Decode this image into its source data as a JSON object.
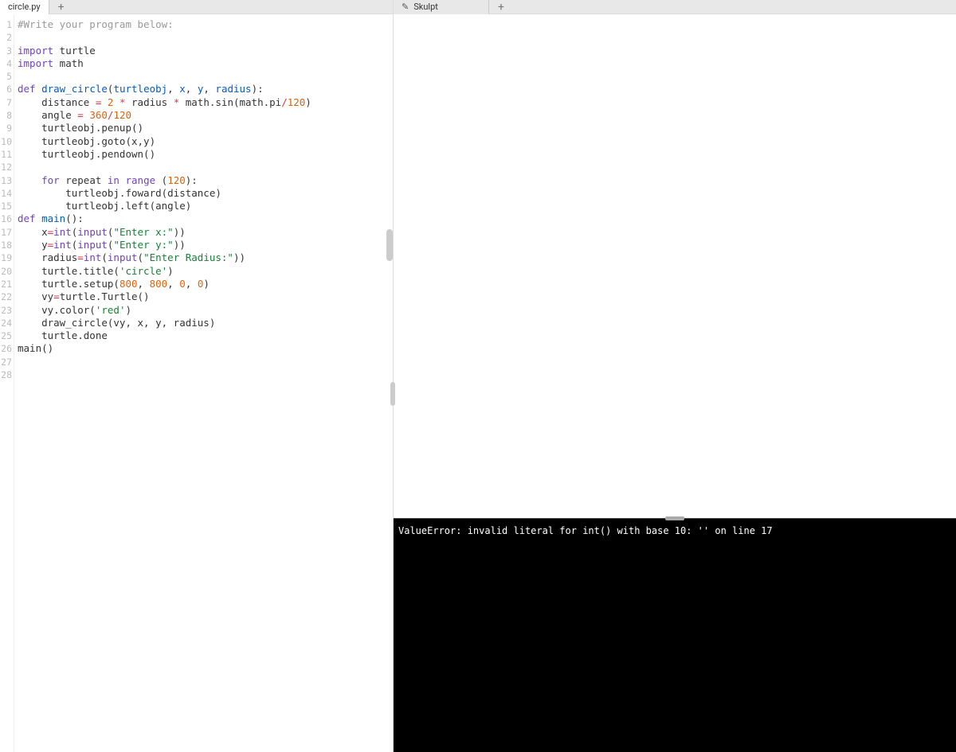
{
  "left_tab": {
    "label": "circle.py"
  },
  "right_tab": {
    "label": "Skulpt",
    "icon": "✎"
  },
  "gutter_max": 28,
  "code_lines": [
    [
      [
        "cmt",
        "#Write your program below:"
      ]
    ],
    [],
    [
      [
        "kw",
        "import"
      ],
      [
        "pl",
        " turtle"
      ]
    ],
    [
      [
        "kw",
        "import"
      ],
      [
        "pl",
        " math"
      ]
    ],
    [],
    [
      [
        "kw",
        "def"
      ],
      [
        "pl",
        " "
      ],
      [
        "fn",
        "draw_circle"
      ],
      [
        "pl",
        "("
      ],
      [
        "param",
        "turtleobj"
      ],
      [
        "pl",
        ", "
      ],
      [
        "param",
        "x"
      ],
      [
        "pl",
        ", "
      ],
      [
        "param",
        "y"
      ],
      [
        "pl",
        ", "
      ],
      [
        "param",
        "radius"
      ],
      [
        "pl",
        ")"
      ],
      [
        "pl",
        ":"
      ]
    ],
    [
      [
        "pl",
        "    distance "
      ],
      [
        "op",
        "="
      ],
      [
        "pl",
        " "
      ],
      [
        "num",
        "2"
      ],
      [
        "pl",
        " "
      ],
      [
        "op",
        "*"
      ],
      [
        "pl",
        " radius "
      ],
      [
        "op",
        "*"
      ],
      [
        "pl",
        " math.sin(math.pi"
      ],
      [
        "op",
        "/"
      ],
      [
        "num",
        "120"
      ],
      [
        "pl",
        ")"
      ]
    ],
    [
      [
        "pl",
        "    angle "
      ],
      [
        "op",
        "="
      ],
      [
        "pl",
        " "
      ],
      [
        "num",
        "360"
      ],
      [
        "op",
        "/"
      ],
      [
        "num",
        "120"
      ]
    ],
    [
      [
        "pl",
        "    turtleobj.penup()"
      ]
    ],
    [
      [
        "pl",
        "    turtleobj.goto(x,y)"
      ]
    ],
    [
      [
        "pl",
        "    turtleobj.pendown()"
      ]
    ],
    [],
    [
      [
        "pl",
        "    "
      ],
      [
        "kw",
        "for"
      ],
      [
        "pl",
        " repeat "
      ],
      [
        "kw",
        "in"
      ],
      [
        "pl",
        " "
      ],
      [
        "bi",
        "range"
      ],
      [
        "pl",
        " ("
      ],
      [
        "num",
        "120"
      ],
      [
        "pl",
        "):"
      ]
    ],
    [
      [
        "pl",
        "        turtleobj.foward(distance)"
      ]
    ],
    [
      [
        "pl",
        "        turtleobj.left(angle)"
      ]
    ],
    [
      [
        "kw",
        "def"
      ],
      [
        "pl",
        " "
      ],
      [
        "fn",
        "main"
      ],
      [
        "pl",
        "():"
      ]
    ],
    [
      [
        "pl",
        "    x"
      ],
      [
        "op",
        "="
      ],
      [
        "bi",
        "int"
      ],
      [
        "pl",
        "("
      ],
      [
        "bi",
        "input"
      ],
      [
        "pl",
        "("
      ],
      [
        "str2",
        "\"Enter x:\""
      ],
      [
        "pl",
        "))"
      ]
    ],
    [
      [
        "pl",
        "    y"
      ],
      [
        "op",
        "="
      ],
      [
        "bi",
        "int"
      ],
      [
        "pl",
        "("
      ],
      [
        "bi",
        "input"
      ],
      [
        "pl",
        "("
      ],
      [
        "str2",
        "\"Enter y:\""
      ],
      [
        "pl",
        "))"
      ]
    ],
    [
      [
        "pl",
        "    radius"
      ],
      [
        "op",
        "="
      ],
      [
        "bi",
        "int"
      ],
      [
        "pl",
        "("
      ],
      [
        "bi",
        "input"
      ],
      [
        "pl",
        "("
      ],
      [
        "str2",
        "\"Enter Radius:\""
      ],
      [
        "pl",
        "))"
      ]
    ],
    [
      [
        "pl",
        "    turtle.title("
      ],
      [
        "str2",
        "'circle'"
      ],
      [
        "pl",
        ")"
      ]
    ],
    [
      [
        "pl",
        "    turtle.setup("
      ],
      [
        "num",
        "800"
      ],
      [
        "pl",
        ", "
      ],
      [
        "num",
        "800"
      ],
      [
        "pl",
        ", "
      ],
      [
        "num",
        "0"
      ],
      [
        "pl",
        ", "
      ],
      [
        "num",
        "0"
      ],
      [
        "pl",
        ")"
      ]
    ],
    [
      [
        "pl",
        "    vy"
      ],
      [
        "op",
        "="
      ],
      [
        "pl",
        "turtle.Turtle()"
      ]
    ],
    [
      [
        "pl",
        "    vy.color("
      ],
      [
        "str2",
        "'red'"
      ],
      [
        "pl",
        ")"
      ]
    ],
    [
      [
        "pl",
        "    draw_circle(vy, x, y, radius)"
      ]
    ],
    [
      [
        "pl",
        "    turtle.done"
      ]
    ],
    [
      [
        "pl",
        "main()"
      ]
    ],
    [],
    []
  ],
  "console_output": "ValueError: invalid literal for int() with base 10: '' on line 17"
}
